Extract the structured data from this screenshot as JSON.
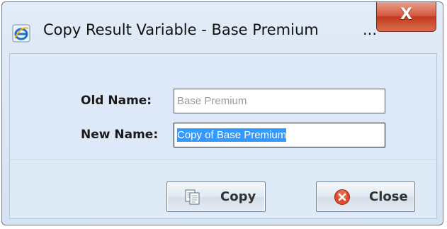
{
  "window": {
    "title": "Copy Result Variable - Base Premium",
    "title_ellipsis": "...",
    "close_glyph": "X"
  },
  "form": {
    "old_name_label": "Old Name:",
    "old_name_value": "Base Premium",
    "new_name_label": "New Name:",
    "new_name_value": "Copy of Base Premium"
  },
  "buttons": {
    "copy_label": "Copy",
    "close_label": "Close"
  },
  "icons": {
    "title": "internet-explorer-icon",
    "copy": "copy-documents-icon",
    "close": "red-circle-x-icon"
  },
  "colors": {
    "selection": "#3399ff",
    "close_button": "#c2391f",
    "panel_background": "#dde9f8"
  }
}
